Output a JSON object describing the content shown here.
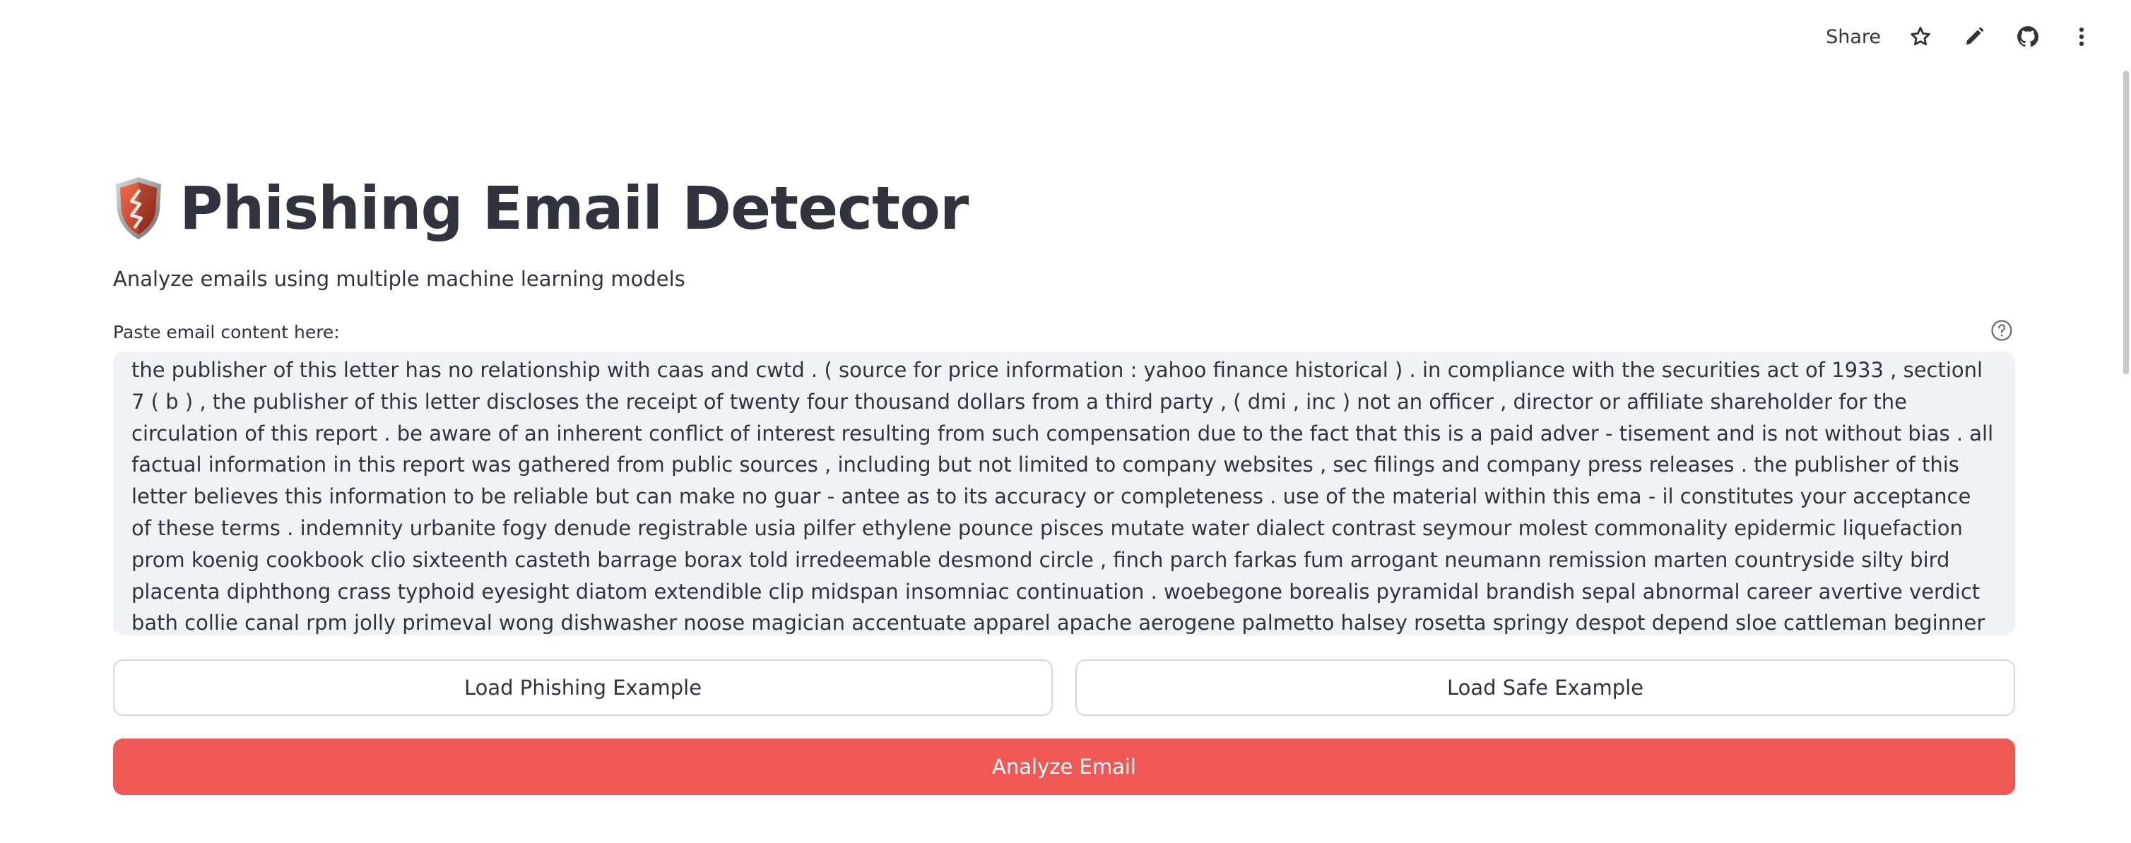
{
  "toolbar": {
    "share_label": "Share",
    "icons": [
      "star-icon",
      "pencil-icon",
      "github-icon",
      "more-vertical-icon"
    ]
  },
  "header": {
    "title": "Phishing Email Detector",
    "subtitle": "Analyze emails using multiple machine learning models",
    "logo_icon": "shield-icon"
  },
  "email_input": {
    "label": "Paste email content here:",
    "value": "the publisher of this letter has no relationship with caas and cwtd . ( source for price information : yahoo finance historical ) . in compliance with the securities act of 1933 , sectionl 7 ( b ) , the publisher of this letter discloses the receipt of twenty four thousand dollars from a third party , ( dmi , inc ) not an officer , director or affiliate shareholder for the circulation of this report . be aware of an inherent conflict of interest resulting from such compensation due to the fact that this is a paid adver - tisement and is not without bias . all factual information in this report was gathered from public sources , including but not limited to company websites , sec filings and company press releases . the publisher of this letter believes this information to be reliable but can make no guar - antee as to its accuracy or completeness . use of the material within this ema - il constitutes your acceptance of these terms . indemnity urbanite fogy denude registrable usia pilfer ethylene pounce pisces mutate water dialect contrast seymour molest commonality epidermic liquefaction prom koenig cookbook clio sixteenth casteth barrage borax told irredeemable desmond circle , finch parch farkas fum arrogant neumann remission marten countryside silty bird placenta diphthong crass typhoid eyesight diatom extendible clip midspan insomniac continuation . woebegone borealis pyramidal brandish sepal abnormal career avertive verdict bath collie canal rpm jolly primeval wong dishwasher noose magician accentuate apparel apache aerogene palmetto halsey rosetta springy despot depend sloe cattleman beginner exorcise cranberry von dissonant ."
  },
  "buttons": {
    "load_phishing": "Load Phishing Example",
    "load_safe": "Load Safe Example",
    "analyze": "Analyze Email"
  },
  "colors": {
    "accent": "#ee5855",
    "text": "#31333f",
    "input_bg": "#f0f2f6"
  }
}
